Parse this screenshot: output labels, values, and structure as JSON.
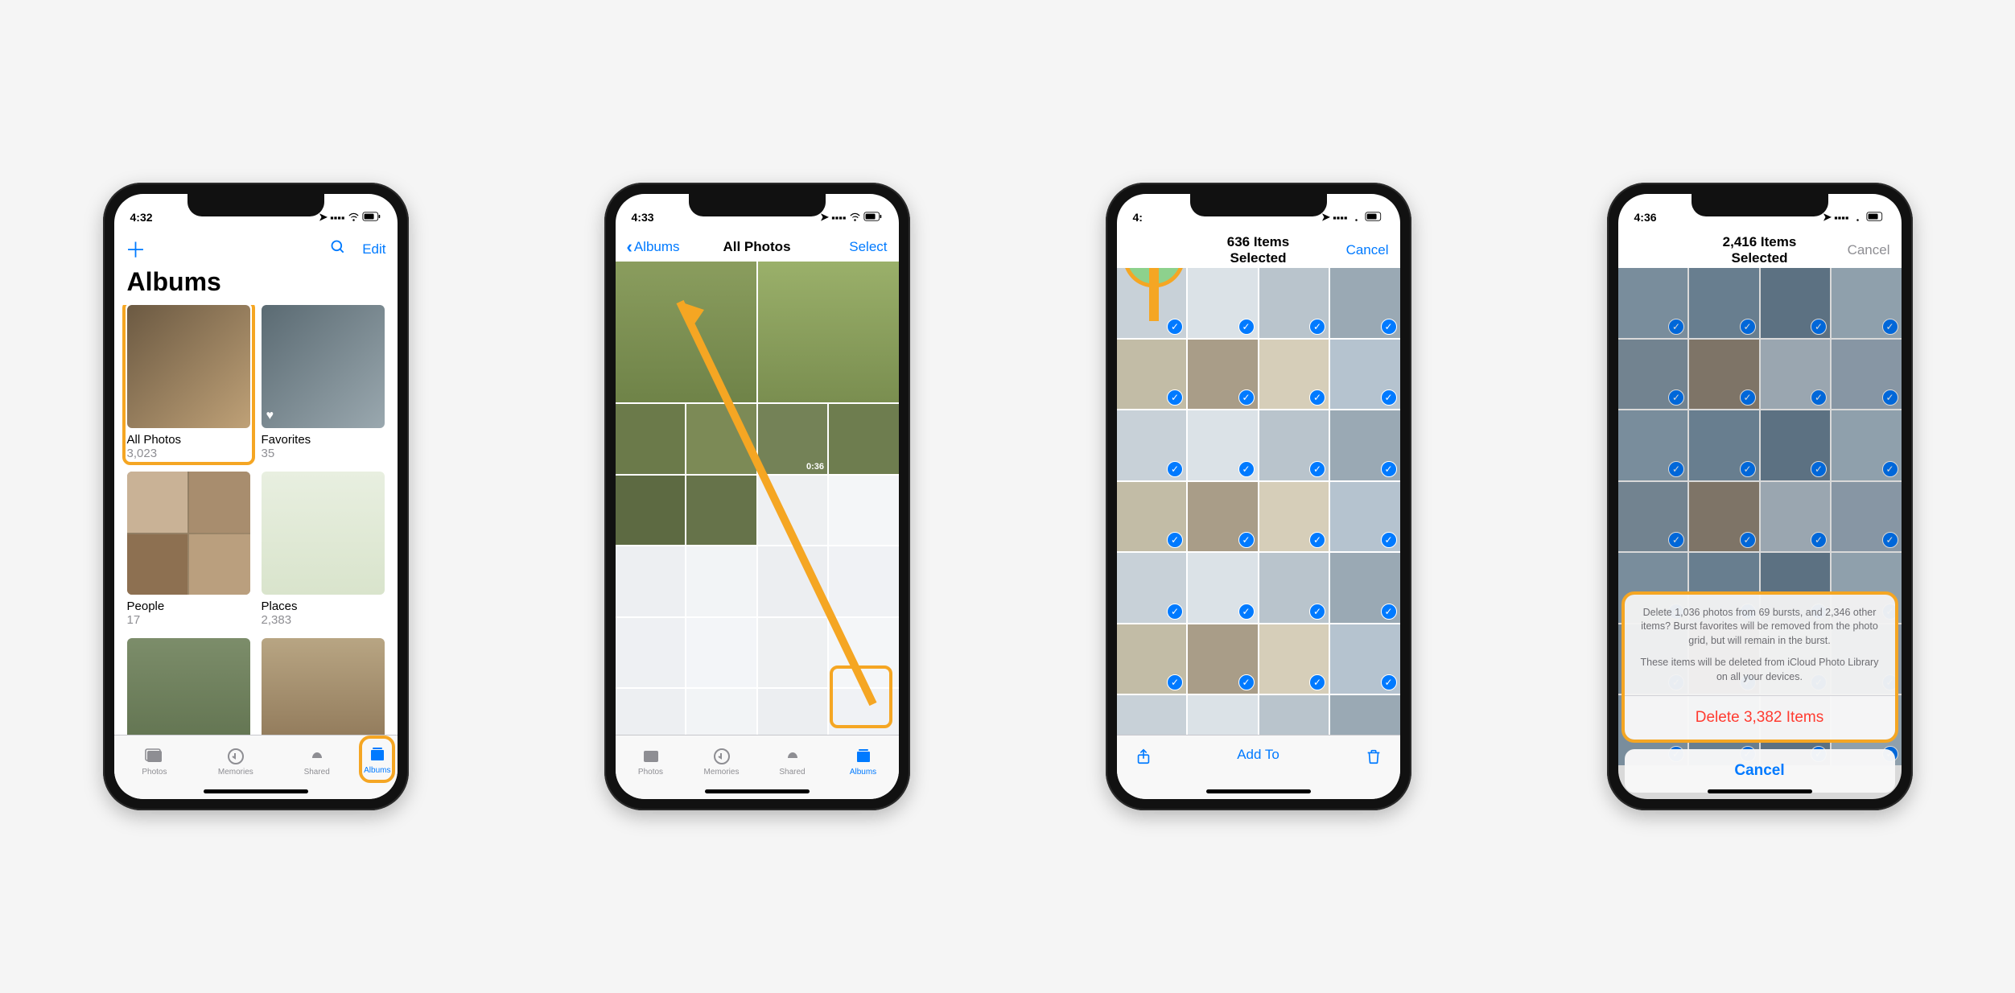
{
  "colors": {
    "accent": "#007aff",
    "highlight": "#f5a623",
    "destructive": "#ff3b30"
  },
  "s1": {
    "time": "4:32",
    "nav": {
      "search": "Search",
      "edit": "Edit"
    },
    "title": "Albums",
    "albums": [
      {
        "name": "All Photos",
        "count": "3,023"
      },
      {
        "name": "Favorites",
        "count": "35"
      },
      {
        "name": "People",
        "count": "17"
      },
      {
        "name": "Places",
        "count": "2,383"
      }
    ],
    "tabs": [
      "Photos",
      "Memories",
      "Shared",
      "Albums"
    ]
  },
  "s2": {
    "time": "4:33",
    "back": "Albums",
    "title": "All Photos",
    "select": "Select",
    "video_badge": "0:36",
    "tabs": [
      "Photos",
      "Memories",
      "Shared",
      "Albums"
    ]
  },
  "s3": {
    "time": "4:",
    "title": "636 Items Selected",
    "cancel": "Cancel",
    "addto": "Add To"
  },
  "s4": {
    "time": "4:36",
    "title": "2,416 Items Selected",
    "cancel": "Cancel",
    "sheet": {
      "msg1": "Delete 1,036 photos from 69 bursts, and 2,346 other items? Burst favorites will be removed from the photo grid, but will remain in the burst.",
      "msg2": "These items will be deleted from iCloud Photo Library on all your devices.",
      "delete": "Delete 3,382 Items",
      "cancel": "Cancel"
    }
  }
}
